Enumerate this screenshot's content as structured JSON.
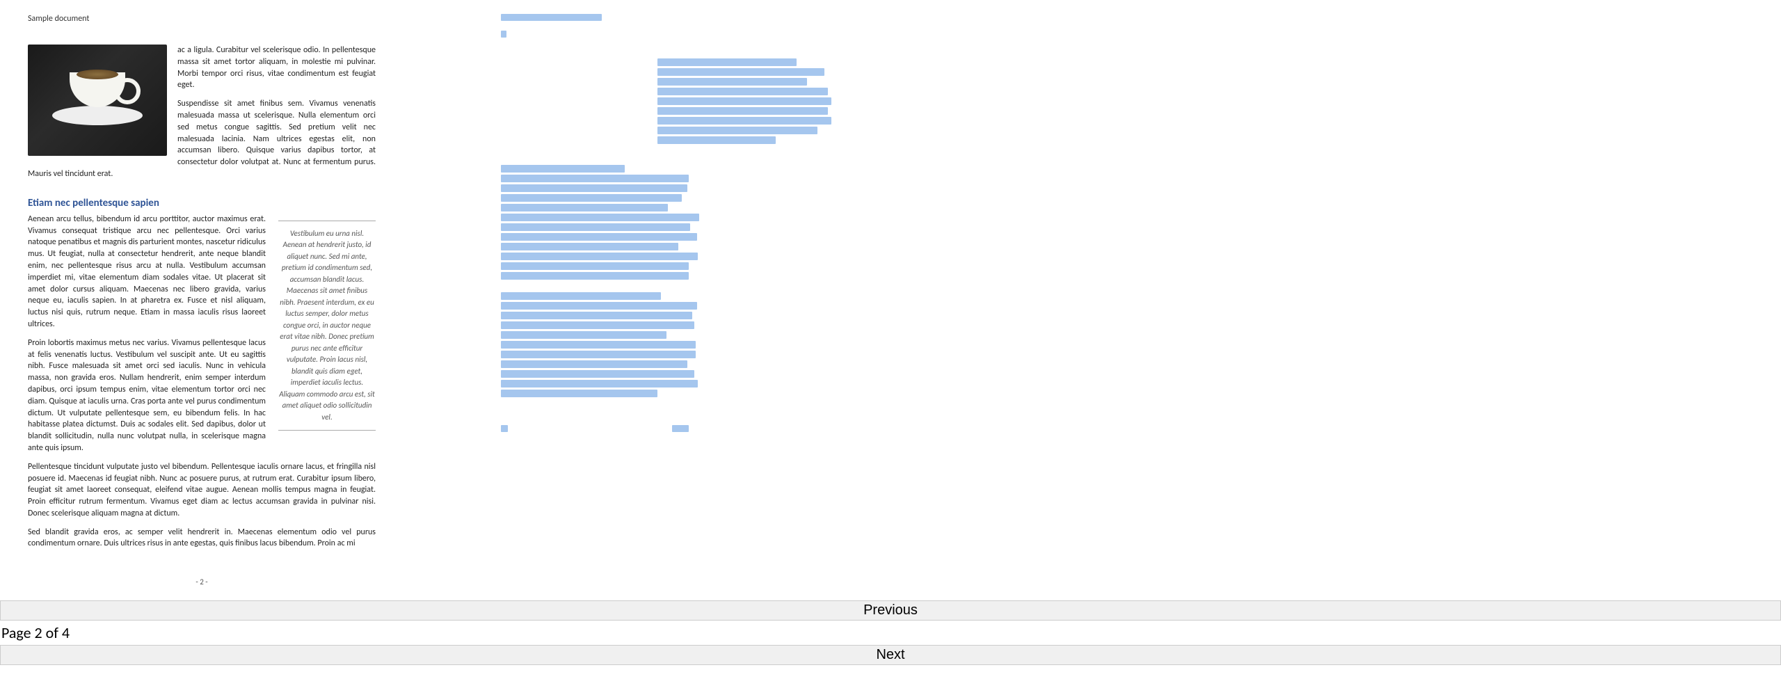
{
  "header_left": "Sample document",
  "para1": "ac a ligula. Curabitur vel scelerisque odio. In pellentesque massa sit amet tortor aliquam, in molestie mi pulvinar. Morbi tempor orci risus, vitae condimentum est feugiat eget.",
  "para2": "Suspendisse sit amet finibus sem. Vivamus venenatis malesuada massa ut scelerisque. Nulla elementum orci sed metus congue sagittis. Sed pretium velit nec malesuada lacinia. Nam ultrices egestas elit, non accumsan libero. Quisque varius dapibus tortor, at consectetur dolor volutpat at. Nunc at fermentum purus. Mauris vel tincidunt erat.",
  "heading": "Etiam nec pellentesque sapien",
  "warning": "Vestibulum eu urna nisl. Aenean at hendrerit justo, id aliquet nunc. Sed mi ante, pretium id condimentum sed, accumsan blandit lacus. Maecenas sit amet finibus nibh. Praesent interdum, ex eu luctus semper, dolor metus congue orci, in auctor neque erat vitae nibh. Donec pretium purus nec ante efficitur vulputate. Proin lacus nisl, blandit quis diam eget, imperdiet iaculis lectus. Aliquam commodo arcu est, sit amet aliquet odio sollicitudin vel.",
  "para3": "Aenean arcu tellus, bibendum id arcu porttitor, auctor maximus erat. Vivamus consequat tristique arcu nec pellentesque. Orci varius natoque penatibus et magnis dis parturient montes, nascetur ridiculus mus. Ut feugiat, nulla at consectetur hendrerit, ante neque blandit enim, nec pellentesque risus arcu at nulla. Vestibulum accumsan imperdiet mi, vitae elementum diam sodales vitae. Ut placerat sit amet dolor cursus aliquam. Maecenas nec libero gravida, varius neque eu, iaculis sapien. In at pharetra ex. Fusce et nisl aliquam, luctus nisi quis, rutrum neque. Etiam in massa iaculis risus laoreet ultrices.",
  "para4": "Proin lobortis maximus metus nec varius. Vivamus pellentesque lacus at felis venenatis luctus. Vestibulum vel suscipit ante. Ut eu sagittis nibh. Fusce malesuada sit amet orci sed iaculis. Nunc in vehicula massa, non gravida eros. Nullam hendrerit, enim semper interdum dapibus, orci ipsum tempus enim, vitae elementum tortor orci nec diam. Quisque at iaculis urna. Cras porta ante vel purus condimentum dictum. Ut vulputate pellentesque sem, eu bibendum felis. In hac habitasse platea dictumst. Duis ac sodales elit. Sed dapibus, dolor ut blandit sollicitudin, nulla nunc volutpat nulla, in scelerisque magna ante quis ipsum.",
  "para5": "Pellentesque tincidunt vulputate justo vel bibendum. Pellentesque iaculis ornare lacus, et fringilla nisl posuere id. Maecenas id feugiat nibh. Nunc ac posuere purus, at rutrum erat. Curabitur ipsum libero, feugiat sit amet laoreet consequat, eleifend vitae augue. Aenean mollis tempus magna in feugiat. Proin efficitur rutrum fermentum. Vivamus eget diam ac lectus accumsan gravida in pulvinar nisi. Donec scelerisque aliquam magna at dictum.",
  "para6": "Sed blandit gravida eros, ac semper velit hendrerit in. Maecenas elementum odio vel purus condimentum ornare. Duis ultrices risus in ante egestas, quis finibus lacus bibendum. Proin ac mi",
  "page_num_left": "- 2 -",
  "nav": {
    "prev": "Previous",
    "indicator": "Page 2 of 4",
    "next": "Next"
  },
  "redact": {
    "header_bar_w": 145,
    "tiny_w": 10,
    "right_block": [
      200,
      240,
      215,
      245,
      250,
      245,
      250,
      230,
      170
    ],
    "left_block_a": [
      178,
      270,
      268,
      260,
      240,
      285,
      272,
      282,
      255,
      283,
      270,
      270
    ],
    "left_block_b": [
      230,
      282,
      275,
      278,
      238,
      280,
      280,
      268,
      278,
      283,
      225
    ],
    "footer_left_w": 10,
    "footer_right_w": 24
  }
}
